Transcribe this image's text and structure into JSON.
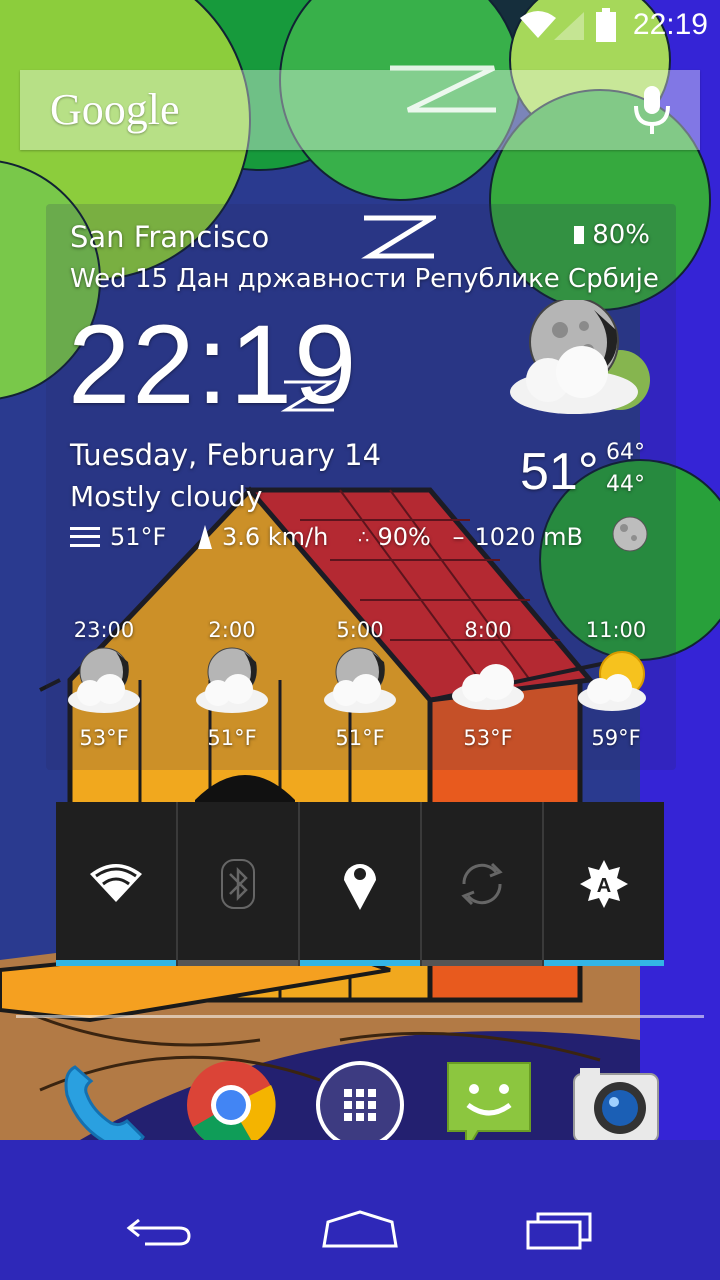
{
  "status_bar": {
    "time": "22:19"
  },
  "search": {
    "logo": "Google",
    "mic_icon": "mic-icon"
  },
  "weather": {
    "city": "San Francisco",
    "date_line": "Wed 15 Дан државности Републике Србије",
    "battery": "80%",
    "clock": "22:19",
    "long_date": "Tuesday, February 14",
    "condition": "Mostly cloudy",
    "feels_like": "51°F",
    "wind": "3.6 km/h",
    "humidity": "90%",
    "pressure": "1020 mB",
    "temp_now": "51°",
    "temp_high": "64°",
    "temp_low": "44°",
    "hourly": [
      {
        "time": "23:00",
        "temp": "53°F",
        "icon": "moon-cloud-icon"
      },
      {
        "time": "2:00",
        "temp": "51°F",
        "icon": "moon-cloud-icon"
      },
      {
        "time": "5:00",
        "temp": "51°F",
        "icon": "moon-cloud-icon"
      },
      {
        "time": "8:00",
        "temp": "53°F",
        "icon": "cloud-icon"
      },
      {
        "time": "11:00",
        "temp": "59°F",
        "icon": "sun-cloud-icon"
      }
    ]
  },
  "toggles": [
    {
      "name": "wifi",
      "icon": "wifi-icon",
      "on": true
    },
    {
      "name": "bluetooth",
      "icon": "bluetooth-icon",
      "on": false
    },
    {
      "name": "location",
      "icon": "location-icon",
      "on": true
    },
    {
      "name": "sync",
      "icon": "sync-icon",
      "on": false
    },
    {
      "name": "brightness",
      "icon": "auto-brightness-icon",
      "on": true
    }
  ],
  "dock": [
    {
      "name": "phone",
      "icon": "phone-icon"
    },
    {
      "name": "chrome",
      "icon": "chrome-icon"
    },
    {
      "name": "app-drawer",
      "icon": "apps-grid-icon"
    },
    {
      "name": "messaging",
      "icon": "messaging-icon"
    },
    {
      "name": "camera",
      "icon": "camera-icon"
    }
  ],
  "colors": {
    "wallpaper_sky": "#2b2f9a",
    "nav_blue": "#2e28b8",
    "toggle_on": "#33b5e5",
    "tree_green": "#79c84a",
    "house_yellow": "#f0a820",
    "roof_red": "#d42a2a"
  }
}
